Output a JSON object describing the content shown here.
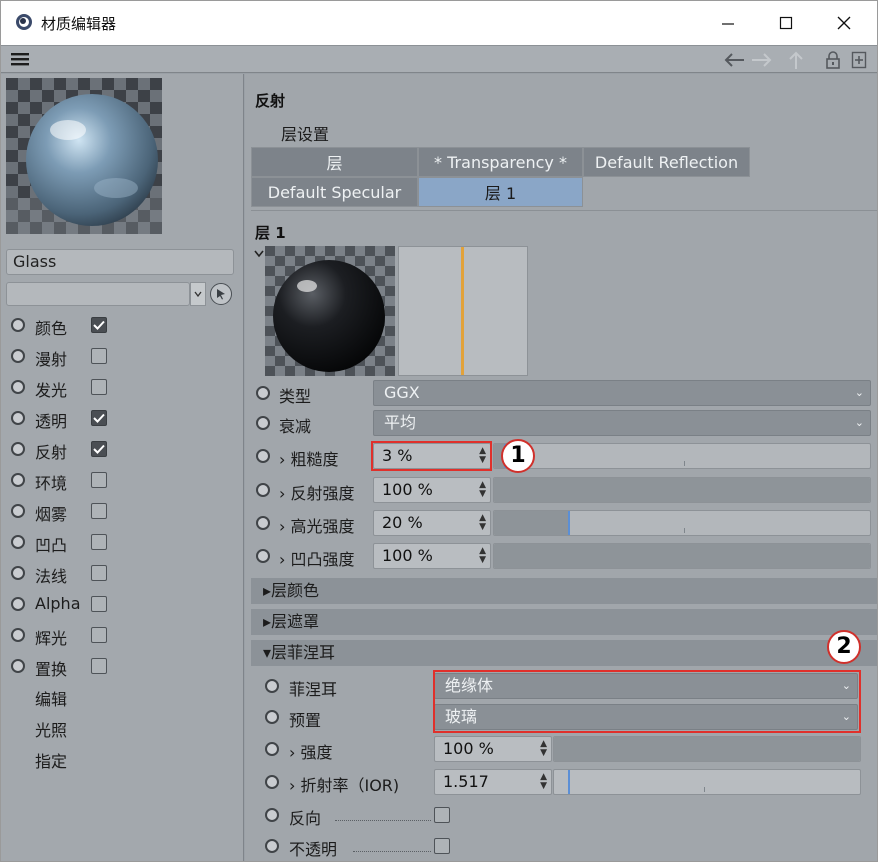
{
  "window": {
    "title": "材质编辑器",
    "minimize_glyph": "—",
    "maximize_glyph": "☐",
    "close_glyph": "✕"
  },
  "material": {
    "name": "Glass",
    "selector_value": ""
  },
  "channels": [
    {
      "label": "颜色",
      "checked": true
    },
    {
      "label": "漫射",
      "checked": false
    },
    {
      "label": "发光",
      "checked": false
    },
    {
      "label": "透明",
      "checked": true
    },
    {
      "label": "反射",
      "checked": true
    },
    {
      "label": "环境",
      "checked": false
    },
    {
      "label": "烟雾",
      "checked": false
    },
    {
      "label": "凹凸",
      "checked": false
    },
    {
      "label": "法线",
      "checked": false
    },
    {
      "label": "Alpha",
      "checked": false
    },
    {
      "label": "辉光",
      "checked": false
    },
    {
      "label": "置换",
      "checked": false
    }
  ],
  "extra_items": [
    "编辑",
    "光照",
    "指定"
  ],
  "reflection": {
    "section_title": "反射",
    "layer_settings_label": "层设置",
    "layers_row1": [
      "层",
      "* Transparency *",
      "Default Reflection"
    ],
    "layers_row2": [
      "Default Specular",
      "层 1"
    ],
    "layer_title": "层 1"
  },
  "props": {
    "type_label": "类型",
    "type_value": "GGX",
    "atten_label": "衰减",
    "atten_value": "平均",
    "roughness_label": "粗糙度",
    "roughness_value": "3 %",
    "roughness_fraction": 0.03,
    "refl_strength_label": "反射强度",
    "refl_strength_value": "100 %",
    "refl_strength_fraction": 1.0,
    "spec_strength_label": "高光强度",
    "spec_strength_value": "20 %",
    "spec_strength_fraction": 0.2,
    "bump_strength_label": "凹凸强度",
    "bump_strength_value": "100 %",
    "bump_strength_fraction": 1.0
  },
  "folds": {
    "layer_color": "层颜色",
    "layer_mask": "层遮罩",
    "layer_fresnel": "层菲涅耳"
  },
  "fresnel": {
    "fresnel_label": "菲涅耳",
    "fresnel_value": "绝缘体",
    "preset_label": "预置",
    "preset_value": "玻璃",
    "strength_label": "强度",
    "strength_value": "100 %",
    "strength_fraction": 1.0,
    "ior_label": "折射率（IOR)",
    "ior_value": "1.517",
    "invert_label": "反向",
    "opaque_label": "不透明"
  },
  "callouts": [
    "1",
    "2"
  ],
  "colors": {
    "panel": "#a1a6ab",
    "selected_layer": "#8aa6c7",
    "highlight_box": "#e0302b",
    "slider_knob": "#5b8fd6"
  }
}
